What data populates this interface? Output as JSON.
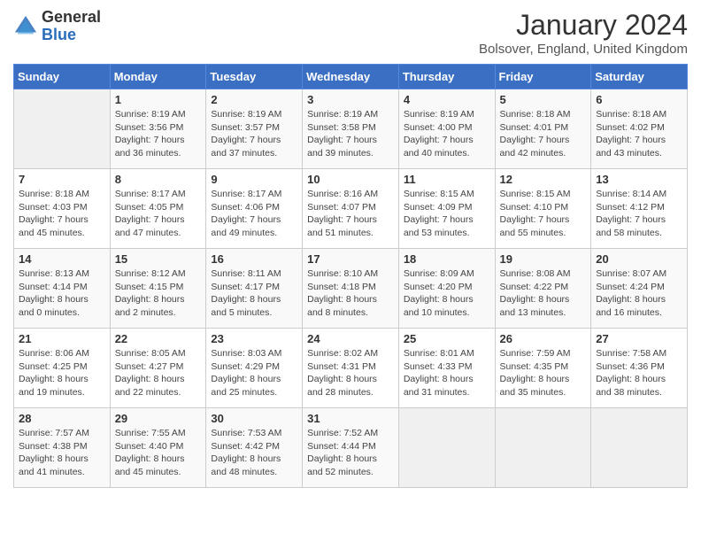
{
  "header": {
    "logo_general": "General",
    "logo_blue": "Blue",
    "month_year": "January 2024",
    "location": "Bolsover, England, United Kingdom"
  },
  "days_of_week": [
    "Sunday",
    "Monday",
    "Tuesday",
    "Wednesday",
    "Thursday",
    "Friday",
    "Saturday"
  ],
  "weeks": [
    [
      {
        "day": "",
        "sunrise": "",
        "sunset": "",
        "daylight": ""
      },
      {
        "day": "1",
        "sunrise": "Sunrise: 8:19 AM",
        "sunset": "Sunset: 3:56 PM",
        "daylight": "Daylight: 7 hours and 36 minutes."
      },
      {
        "day": "2",
        "sunrise": "Sunrise: 8:19 AM",
        "sunset": "Sunset: 3:57 PM",
        "daylight": "Daylight: 7 hours and 37 minutes."
      },
      {
        "day": "3",
        "sunrise": "Sunrise: 8:19 AM",
        "sunset": "Sunset: 3:58 PM",
        "daylight": "Daylight: 7 hours and 39 minutes."
      },
      {
        "day": "4",
        "sunrise": "Sunrise: 8:19 AM",
        "sunset": "Sunset: 4:00 PM",
        "daylight": "Daylight: 7 hours and 40 minutes."
      },
      {
        "day": "5",
        "sunrise": "Sunrise: 8:18 AM",
        "sunset": "Sunset: 4:01 PM",
        "daylight": "Daylight: 7 hours and 42 minutes."
      },
      {
        "day": "6",
        "sunrise": "Sunrise: 8:18 AM",
        "sunset": "Sunset: 4:02 PM",
        "daylight": "Daylight: 7 hours and 43 minutes."
      }
    ],
    [
      {
        "day": "7",
        "sunrise": "Sunrise: 8:18 AM",
        "sunset": "Sunset: 4:03 PM",
        "daylight": "Daylight: 7 hours and 45 minutes."
      },
      {
        "day": "8",
        "sunrise": "Sunrise: 8:17 AM",
        "sunset": "Sunset: 4:05 PM",
        "daylight": "Daylight: 7 hours and 47 minutes."
      },
      {
        "day": "9",
        "sunrise": "Sunrise: 8:17 AM",
        "sunset": "Sunset: 4:06 PM",
        "daylight": "Daylight: 7 hours and 49 minutes."
      },
      {
        "day": "10",
        "sunrise": "Sunrise: 8:16 AM",
        "sunset": "Sunset: 4:07 PM",
        "daylight": "Daylight: 7 hours and 51 minutes."
      },
      {
        "day": "11",
        "sunrise": "Sunrise: 8:15 AM",
        "sunset": "Sunset: 4:09 PM",
        "daylight": "Daylight: 7 hours and 53 minutes."
      },
      {
        "day": "12",
        "sunrise": "Sunrise: 8:15 AM",
        "sunset": "Sunset: 4:10 PM",
        "daylight": "Daylight: 7 hours and 55 minutes."
      },
      {
        "day": "13",
        "sunrise": "Sunrise: 8:14 AM",
        "sunset": "Sunset: 4:12 PM",
        "daylight": "Daylight: 7 hours and 58 minutes."
      }
    ],
    [
      {
        "day": "14",
        "sunrise": "Sunrise: 8:13 AM",
        "sunset": "Sunset: 4:14 PM",
        "daylight": "Daylight: 8 hours and 0 minutes."
      },
      {
        "day": "15",
        "sunrise": "Sunrise: 8:12 AM",
        "sunset": "Sunset: 4:15 PM",
        "daylight": "Daylight: 8 hours and 2 minutes."
      },
      {
        "day": "16",
        "sunrise": "Sunrise: 8:11 AM",
        "sunset": "Sunset: 4:17 PM",
        "daylight": "Daylight: 8 hours and 5 minutes."
      },
      {
        "day": "17",
        "sunrise": "Sunrise: 8:10 AM",
        "sunset": "Sunset: 4:18 PM",
        "daylight": "Daylight: 8 hours and 8 minutes."
      },
      {
        "day": "18",
        "sunrise": "Sunrise: 8:09 AM",
        "sunset": "Sunset: 4:20 PM",
        "daylight": "Daylight: 8 hours and 10 minutes."
      },
      {
        "day": "19",
        "sunrise": "Sunrise: 8:08 AM",
        "sunset": "Sunset: 4:22 PM",
        "daylight": "Daylight: 8 hours and 13 minutes."
      },
      {
        "day": "20",
        "sunrise": "Sunrise: 8:07 AM",
        "sunset": "Sunset: 4:24 PM",
        "daylight": "Daylight: 8 hours and 16 minutes."
      }
    ],
    [
      {
        "day": "21",
        "sunrise": "Sunrise: 8:06 AM",
        "sunset": "Sunset: 4:25 PM",
        "daylight": "Daylight: 8 hours and 19 minutes."
      },
      {
        "day": "22",
        "sunrise": "Sunrise: 8:05 AM",
        "sunset": "Sunset: 4:27 PM",
        "daylight": "Daylight: 8 hours and 22 minutes."
      },
      {
        "day": "23",
        "sunrise": "Sunrise: 8:03 AM",
        "sunset": "Sunset: 4:29 PM",
        "daylight": "Daylight: 8 hours and 25 minutes."
      },
      {
        "day": "24",
        "sunrise": "Sunrise: 8:02 AM",
        "sunset": "Sunset: 4:31 PM",
        "daylight": "Daylight: 8 hours and 28 minutes."
      },
      {
        "day": "25",
        "sunrise": "Sunrise: 8:01 AM",
        "sunset": "Sunset: 4:33 PM",
        "daylight": "Daylight: 8 hours and 31 minutes."
      },
      {
        "day": "26",
        "sunrise": "Sunrise: 7:59 AM",
        "sunset": "Sunset: 4:35 PM",
        "daylight": "Daylight: 8 hours and 35 minutes."
      },
      {
        "day": "27",
        "sunrise": "Sunrise: 7:58 AM",
        "sunset": "Sunset: 4:36 PM",
        "daylight": "Daylight: 8 hours and 38 minutes."
      }
    ],
    [
      {
        "day": "28",
        "sunrise": "Sunrise: 7:57 AM",
        "sunset": "Sunset: 4:38 PM",
        "daylight": "Daylight: 8 hours and 41 minutes."
      },
      {
        "day": "29",
        "sunrise": "Sunrise: 7:55 AM",
        "sunset": "Sunset: 4:40 PM",
        "daylight": "Daylight: 8 hours and 45 minutes."
      },
      {
        "day": "30",
        "sunrise": "Sunrise: 7:53 AM",
        "sunset": "Sunset: 4:42 PM",
        "daylight": "Daylight: 8 hours and 48 minutes."
      },
      {
        "day": "31",
        "sunrise": "Sunrise: 7:52 AM",
        "sunset": "Sunset: 4:44 PM",
        "daylight": "Daylight: 8 hours and 52 minutes."
      },
      {
        "day": "",
        "sunrise": "",
        "sunset": "",
        "daylight": ""
      },
      {
        "day": "",
        "sunrise": "",
        "sunset": "",
        "daylight": ""
      },
      {
        "day": "",
        "sunrise": "",
        "sunset": "",
        "daylight": ""
      }
    ]
  ]
}
